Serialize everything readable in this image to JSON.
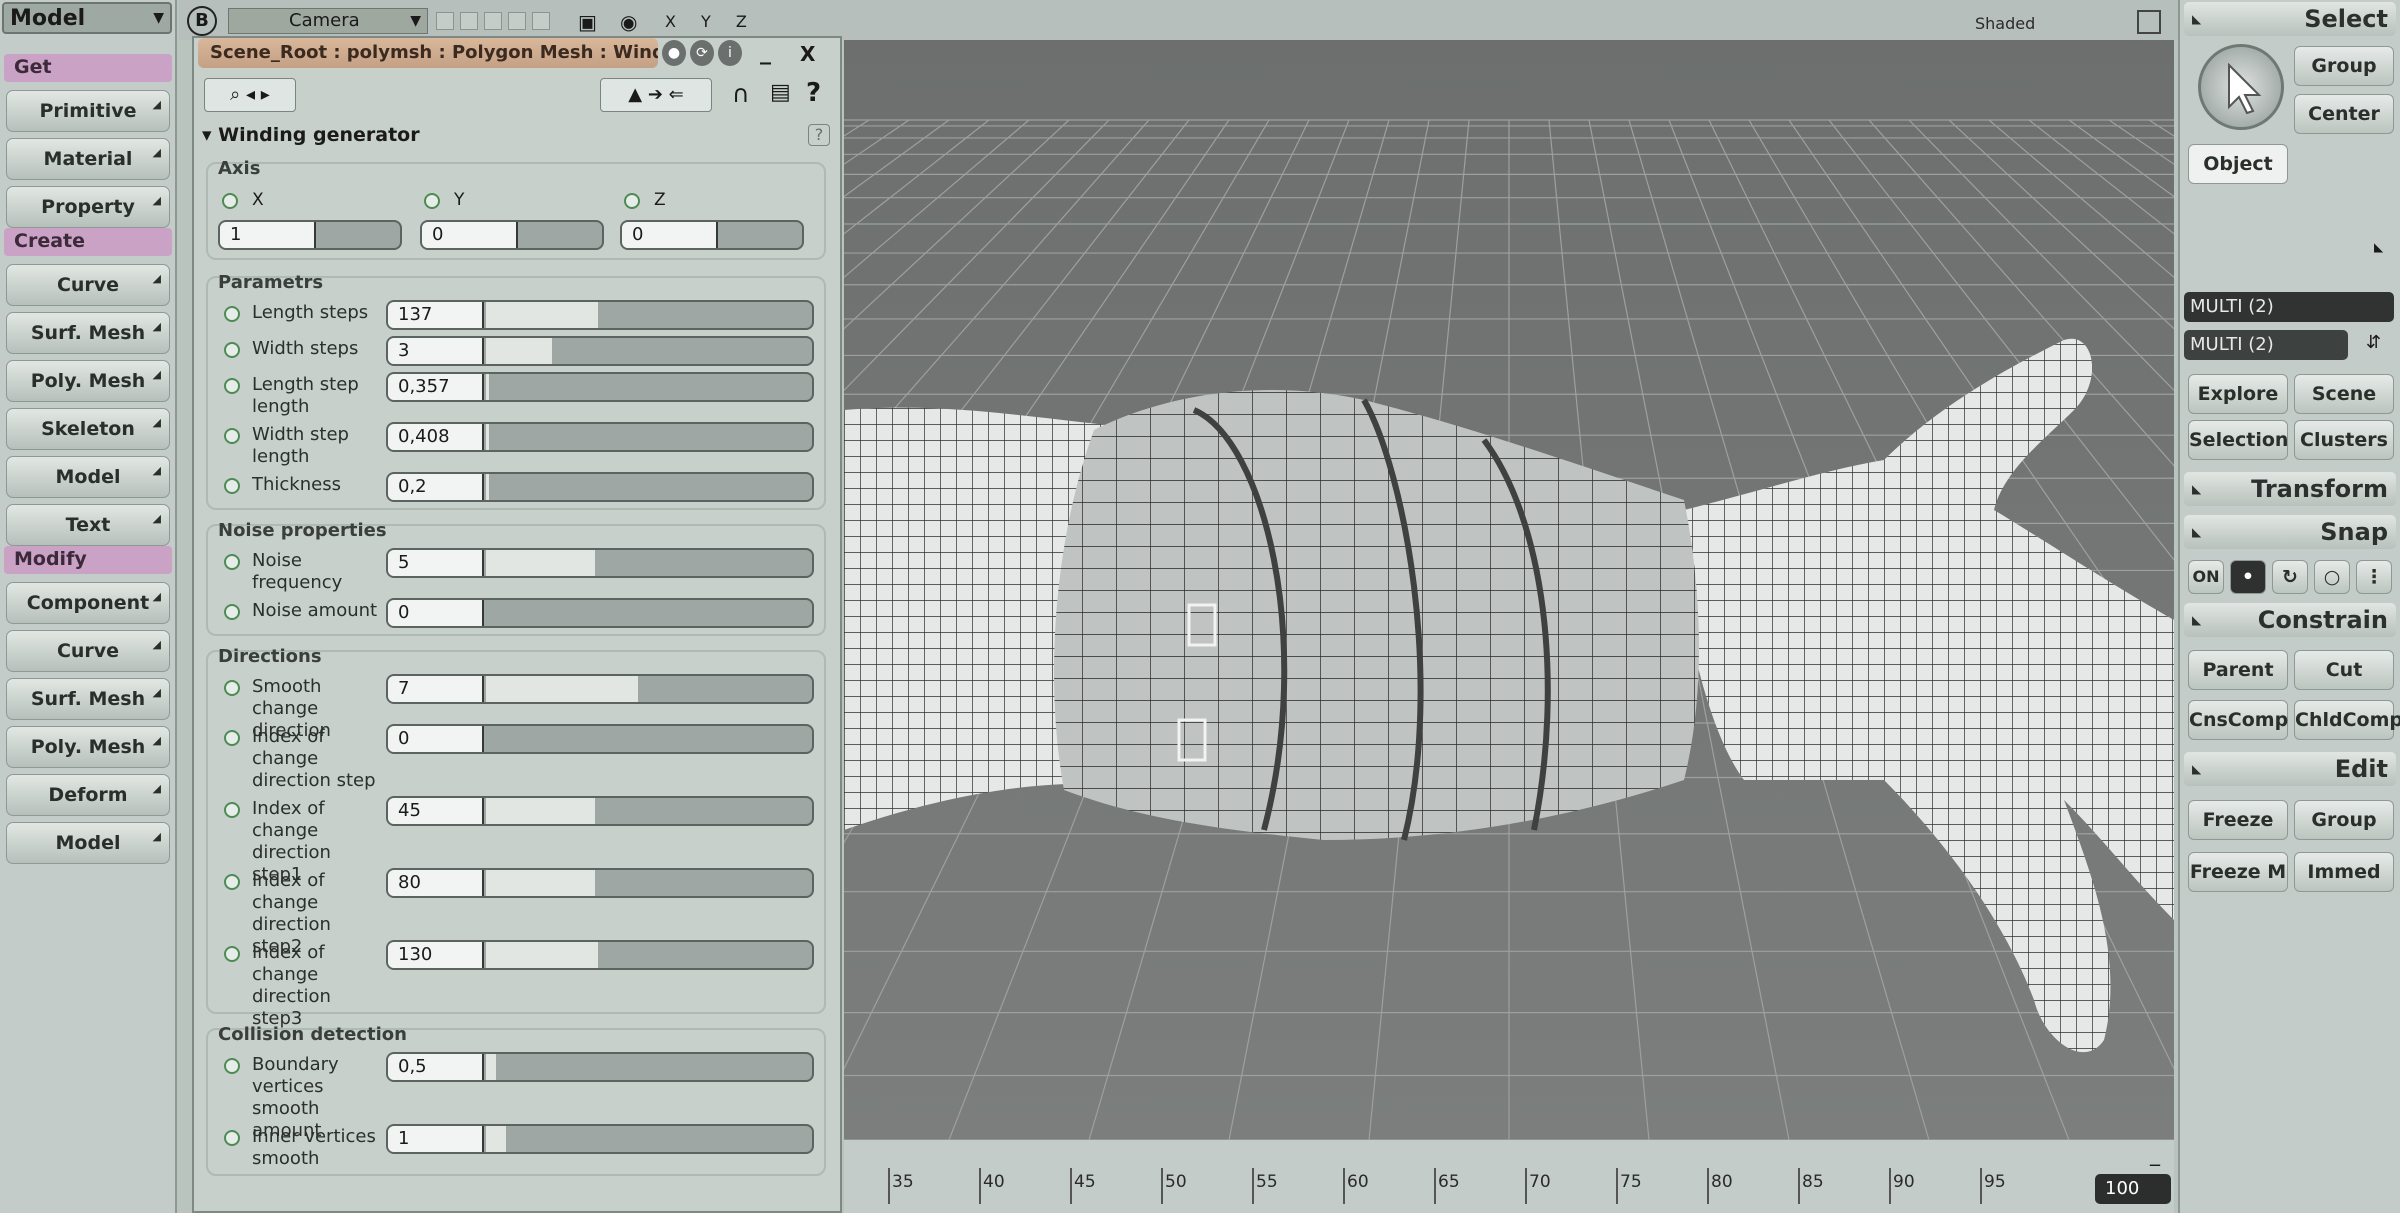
{
  "left": {
    "mode": "Model",
    "sections": [
      {
        "header": "Get",
        "items": [
          "Primitive",
          "Material",
          "Property"
        ]
      },
      {
        "header": "Create",
        "items": [
          "Curve",
          "Surf. Mesh",
          "Poly. Mesh",
          "Skeleton",
          "Model",
          "Text"
        ]
      },
      {
        "header": "Modify",
        "items": [
          "Component",
          "Curve",
          "Surf. Mesh",
          "Poly. Mesh",
          "Deform",
          "Model"
        ]
      }
    ]
  },
  "topbar": {
    "b": "B",
    "camera": "Camera",
    "axes": "X Y Z",
    "shaded": "Shaded"
  },
  "panel": {
    "title": "Scene_Root : polymsh : Polygon Mesh : Windi...",
    "close": "X",
    "minimize": "_",
    "section": "Winding generator",
    "axis": {
      "label": "Axis",
      "items": [
        {
          "name": "X",
          "value": "1"
        },
        {
          "name": "Y",
          "value": "0"
        },
        {
          "name": "Z",
          "value": "0"
        }
      ]
    },
    "groups": [
      {
        "label": "Parametrs",
        "params": [
          {
            "label": "Length steps",
            "value": "137",
            "fill": 0.34
          },
          {
            "label": "Width steps",
            "value": "3",
            "fill": 0.2
          },
          {
            "label": "Length step length",
            "value": "0,357",
            "fill": 0.01
          },
          {
            "label": "Width step length",
            "value": "0,408",
            "fill": 0.01
          },
          {
            "label": "Thickness",
            "value": "0,2",
            "fill": 0.01
          }
        ]
      },
      {
        "label": "Noise properties",
        "params": [
          {
            "label": "Noise frequency",
            "value": "5",
            "fill": 0.33
          },
          {
            "label": "Noise amount",
            "value": "0",
            "fill": 0.0
          }
        ]
      },
      {
        "label": "Directions",
        "params": [
          {
            "label": "Smooth change direction",
            "value": "7",
            "fill": 0.46
          },
          {
            "label": "Index of change direction step",
            "value": "0",
            "fill": 0.0
          },
          {
            "label": "Index of change direction step1",
            "value": "45",
            "fill": 0.33
          },
          {
            "label": "Index of change direction step2",
            "value": "80",
            "fill": 0.33
          },
          {
            "label": "Index of change direction step3",
            "value": "130",
            "fill": 0.34
          }
        ]
      },
      {
        "label": "Collision detection",
        "params": [
          {
            "label": "Boundary vertices smooth amount",
            "value": "0,5",
            "fill": 0.03
          },
          {
            "label": "Inner vertices smooth",
            "value": "1",
            "fill": 0.06
          }
        ]
      }
    ]
  },
  "timeline": {
    "ticks": [
      "35",
      "40",
      "45",
      "50",
      "55",
      "60",
      "65",
      "70",
      "75",
      "80",
      "85",
      "90",
      "95"
    ],
    "frame": "100"
  },
  "right": {
    "select": "Select",
    "group": "Group",
    "center": "Center",
    "object": "Object",
    "multi1": "MULTI (2)",
    "multi2": "MULTI (2)",
    "explore": "Explore",
    "scene": "Scene",
    "selection": "Selection",
    "clusters": "Clusters",
    "transform": "Transform",
    "snap": "Snap",
    "snap_on": "ON",
    "constrain": "Constrain",
    "parent": "Parent",
    "cut": "Cut",
    "cnscomp": "CnsComp",
    "chldcomp": "ChldComp",
    "edit": "Edit",
    "freeze": "Freeze",
    "edit_group": "Group",
    "freeze_m": "Freeze M",
    "immed": "Immed"
  }
}
